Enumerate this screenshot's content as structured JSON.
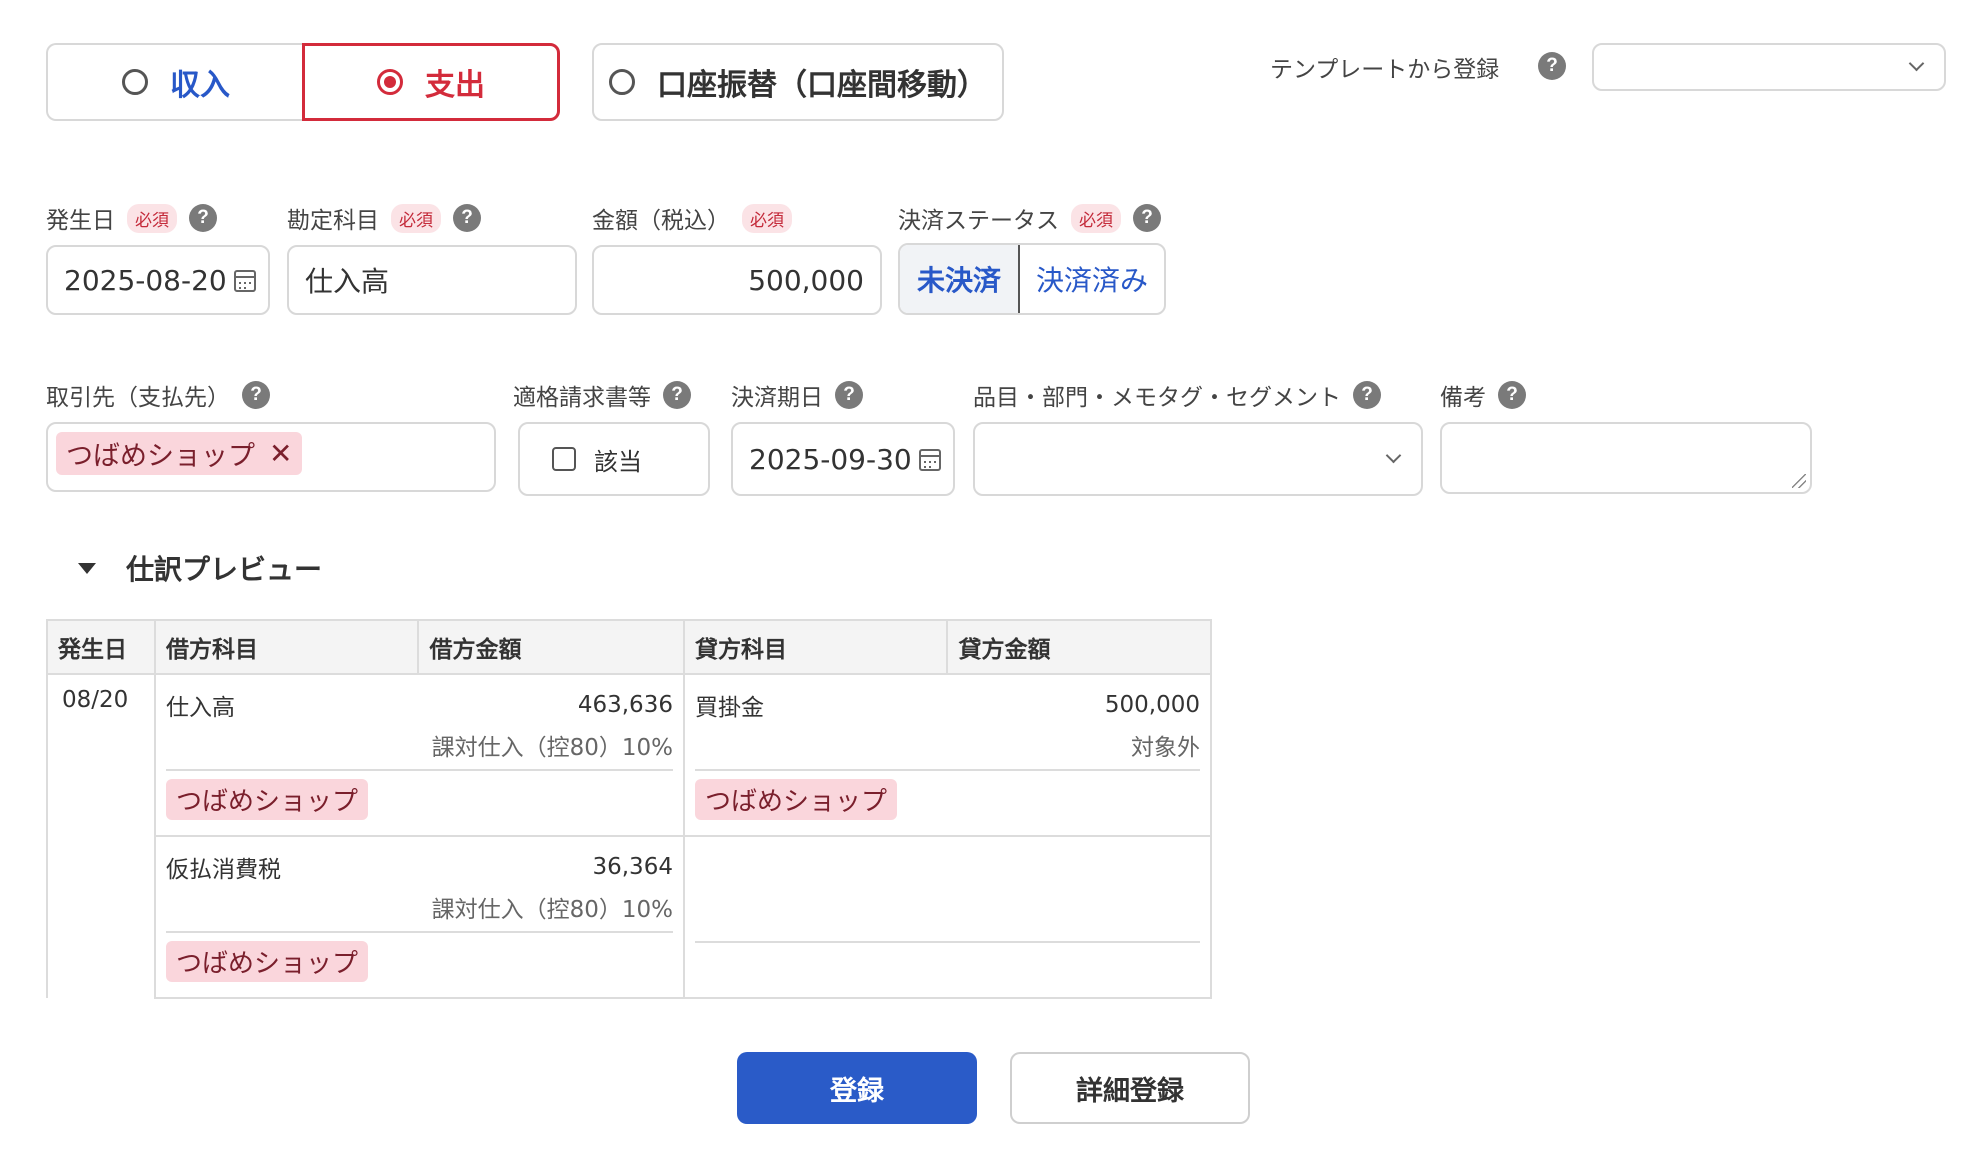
{
  "type_tabs": [
    {
      "label": "収入",
      "checked": false
    },
    {
      "label": "支出",
      "checked": true
    },
    {
      "label": "口座振替（口座間移動）",
      "checked": false
    }
  ],
  "template": {
    "label": "テンプレートから登録",
    "value": ""
  },
  "required_badge": "必須",
  "help_glyph": "?",
  "fields": {
    "date": {
      "label": "発生日",
      "value": "2025-08-20"
    },
    "account": {
      "label": "勘定科目",
      "value": "仕入高"
    },
    "amount": {
      "label": "金額（税込）",
      "value": "500,000"
    },
    "status": {
      "label": "決済ステータス",
      "options": [
        "未決済",
        "決済済み"
      ],
      "selected": "未決済"
    },
    "partner": {
      "label": "取引先（支払先）",
      "tag": "つばめショップ",
      "remove": "✕"
    },
    "invoice": {
      "label": "適格請求書等",
      "checkbox_label": "該当",
      "checked": false
    },
    "due_date": {
      "label": "決済期日",
      "value": "2025-09-30"
    },
    "segments": {
      "label": "品目・部門・メモタグ・セグメント",
      "value": ""
    },
    "memo": {
      "label": "備考",
      "value": ""
    }
  },
  "preview": {
    "title": "仕訳プレビュー",
    "columns": [
      "発生日",
      "借方科目",
      "借方金額",
      "貸方科目",
      "貸方金額"
    ],
    "date": "08/20",
    "debit": [
      {
        "account": "仕入高",
        "amount": "463,636",
        "tax": "課対仕入（控80）10%",
        "partner": "つばめショップ"
      },
      {
        "account": "仮払消費税",
        "amount": "36,364",
        "tax": "課対仕入（控80）10%",
        "partner": "つばめショップ"
      }
    ],
    "credit": [
      {
        "account": "買掛金",
        "amount": "500,000",
        "tax": "対象外",
        "partner": "つばめショップ"
      }
    ]
  },
  "buttons": {
    "submit": "登録",
    "detail": "詳細登録"
  },
  "colors": {
    "primary": "#2a5bc8",
    "expense": "#d32b3b",
    "income": "#2858c8",
    "tag_bg": "#fad6dc"
  }
}
